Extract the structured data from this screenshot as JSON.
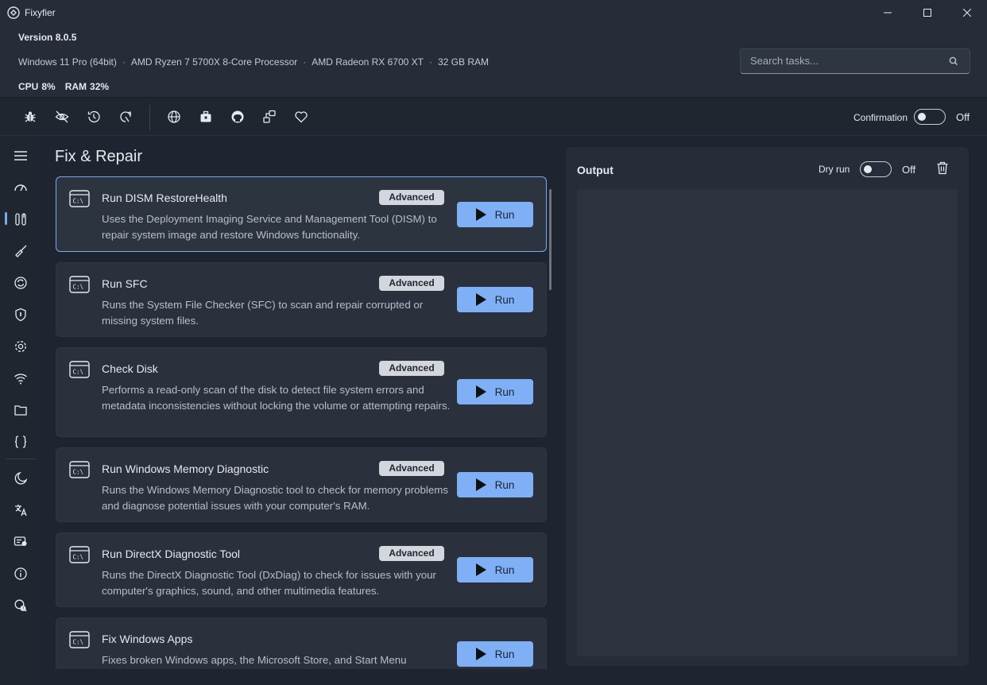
{
  "app": {
    "title": "Fixyfier",
    "version": "Version 8.0.5"
  },
  "system": {
    "info": [
      "Windows 11 Pro (64bit)",
      "AMD Ryzen 7 5700X 8-Core Processor",
      "AMD Radeon RX 6700 XT",
      "32 GB RAM"
    ],
    "separator": "·",
    "cpu_label": "CPU",
    "cpu_value": "8%",
    "ram_label": "RAM",
    "ram_value": "32%"
  },
  "search": {
    "placeholder": "Search tasks..."
  },
  "toolbar": {
    "icons": [
      "bug-icon",
      "eye-off-icon",
      "history-icon",
      "restore-icon",
      "globe-icon",
      "toolbox-icon",
      "github-icon",
      "share-icon",
      "heart-icon"
    ],
    "confirmation_label": "Confirmation",
    "confirmation_state": "Off"
  },
  "sidebar": {
    "items": [
      "menu-icon",
      "speedometer-icon",
      "repair-tools-icon",
      "broom-icon",
      "sync-icon",
      "shield-icon",
      "gear-icon",
      "wifi-icon",
      "folder-icon",
      "braces-icon",
      "moon-icon",
      "language-icon",
      "license-icon",
      "info-icon",
      "search-help-icon"
    ],
    "active_index": 2
  },
  "main": {
    "title": "Fix & Repair",
    "tasks": [
      {
        "title": "Run DISM RestoreHealth",
        "badge": "Advanced",
        "description": "Uses the Deployment Imaging Service and Management Tool (DISM) to repair system image and restore Windows functionality.",
        "run_label": "Run"
      },
      {
        "title": "Run SFC",
        "badge": "Advanced",
        "description": "Runs the System File Checker (SFC) to scan and repair corrupted or missing system files.",
        "run_label": "Run"
      },
      {
        "title": "Check Disk",
        "badge": "Advanced",
        "description": "Performs a read-only scan of the disk to detect file system errors and metadata inconsistencies without locking the volume or attempting repairs.",
        "run_label": "Run"
      },
      {
        "title": "Run Windows Memory Diagnostic",
        "badge": "Advanced",
        "description": "Runs the Windows Memory Diagnostic tool to check for memory problems and diagnose potential issues with your computer's RAM.",
        "run_label": "Run"
      },
      {
        "title": "Run DirectX Diagnostic Tool",
        "badge": "Advanced",
        "description": "Runs the DirectX Diagnostic Tool (DxDiag) to check for issues with your computer's graphics, sound, and other multimedia features.",
        "run_label": "Run"
      },
      {
        "title": "Fix Windows Apps",
        "badge": "",
        "description": "Fixes broken Windows apps, the Microsoft Store, and Start Menu",
        "run_label": "Run"
      }
    ]
  },
  "output": {
    "title": "Output",
    "dry_run_label": "Dry run",
    "dry_run_state": "Off"
  },
  "colors": {
    "accent": "#7fb0f6",
    "background": "#1e2530",
    "panel": "#262d38",
    "card": "#2a313c"
  }
}
